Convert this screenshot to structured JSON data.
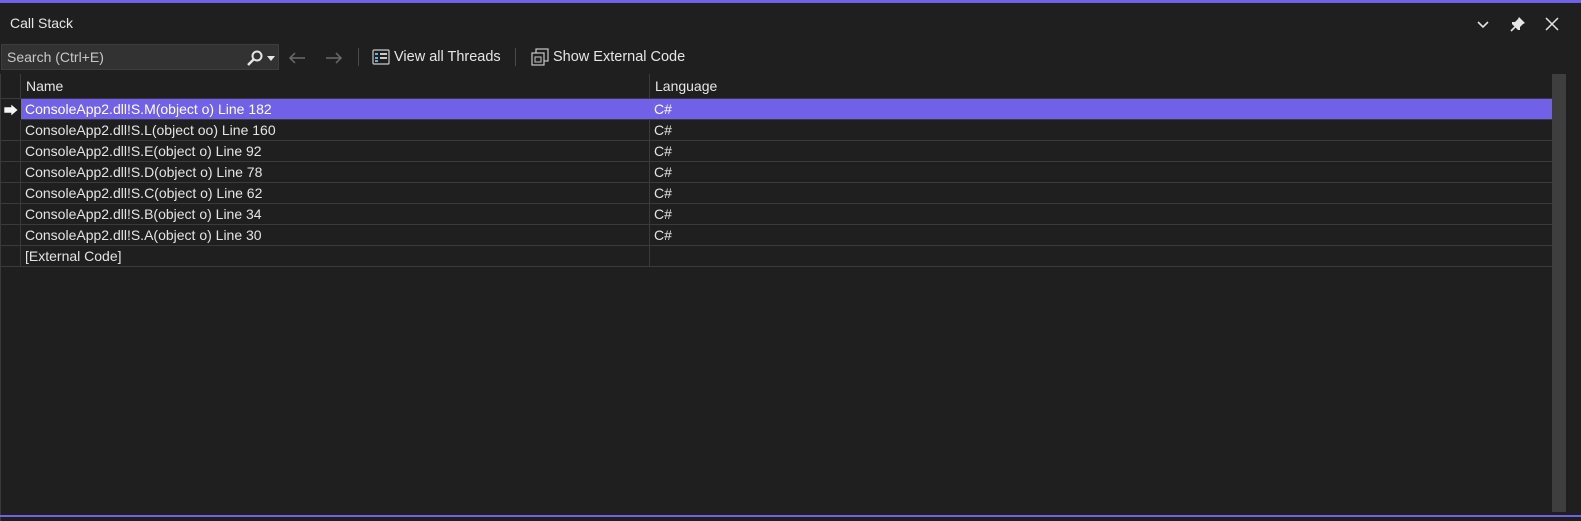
{
  "window": {
    "title": "Call Stack"
  },
  "toolbar": {
    "search_placeholder": "Search (Ctrl+E)",
    "view_threads_label": "View all Threads",
    "show_external_label": "Show External Code"
  },
  "columns": {
    "name": "Name",
    "language": "Language"
  },
  "rows": [
    {
      "name": "ConsoleApp2.dll!S.M(object o) Line 182",
      "language": "C#"
    },
    {
      "name": "ConsoleApp2.dll!S.L(object oo) Line 160",
      "language": "C#"
    },
    {
      "name": "ConsoleApp2.dll!S.E(object o) Line 92",
      "language": "C#"
    },
    {
      "name": "ConsoleApp2.dll!S.D(object o) Line 78",
      "language": "C#"
    },
    {
      "name": "ConsoleApp2.dll!S.C(object o) Line 62",
      "language": "C#"
    },
    {
      "name": "ConsoleApp2.dll!S.B(object o) Line 34",
      "language": "C#"
    },
    {
      "name": "ConsoleApp2.dll!S.A(object o) Line 30",
      "language": "C#"
    },
    {
      "name": "[External Code]",
      "language": ""
    }
  ],
  "colors": {
    "accent": "#7160e8",
    "background": "#1f1f1f",
    "text": "#e4e4e4"
  }
}
